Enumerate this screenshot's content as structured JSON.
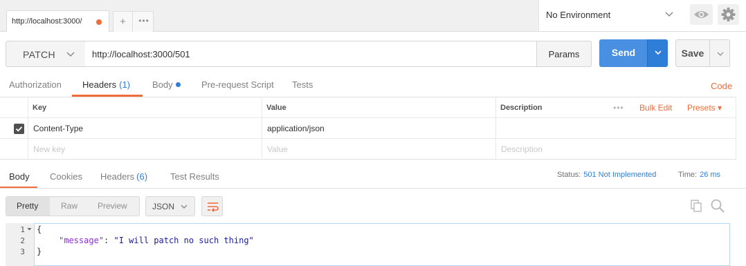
{
  "tabs": {
    "active_tab_label": "http://localhost:3000/",
    "new_tab_glyph": "+",
    "more_glyph": "•••"
  },
  "environment": {
    "selected": "No Environment"
  },
  "request": {
    "method": "PATCH",
    "url": "http://localhost:3000/501",
    "params_label": "Params",
    "send_label": "Send",
    "save_label": "Save"
  },
  "request_tabs": {
    "authorization": "Authorization",
    "headers": "Headers",
    "headers_count": "(1)",
    "body": "Body",
    "prerequest": "Pre-request Script",
    "tests": "Tests",
    "code_link": "Code"
  },
  "headers_table": {
    "columns": {
      "key": "Key",
      "value": "Value",
      "description": "Description"
    },
    "more_glyph": "•••",
    "bulk_edit": "Bulk Edit",
    "presets": "Presets ▾",
    "rows": [
      {
        "key": "Content-Type",
        "value": "application/json",
        "description": "",
        "checked": true
      }
    ],
    "new_row": {
      "key_placeholder": "New key",
      "value_placeholder": "Value",
      "description_placeholder": "Description"
    }
  },
  "response_tabs": {
    "body": "Body",
    "cookies": "Cookies",
    "headers": "Headers",
    "headers_count": "(6)",
    "test_results": "Test Results"
  },
  "response_status": {
    "status_label": "Status:",
    "status_value": "501 Not Implemented",
    "time_label": "Time:",
    "time_value": "26 ms"
  },
  "response_view": {
    "pretty": "Pretty",
    "raw": "Raw",
    "preview": "Preview",
    "format": "JSON"
  },
  "code": {
    "line_numbers": [
      "1",
      "2",
      "3"
    ],
    "line1": "{",
    "line2_key": "\"message\"",
    "line2_sep": ": ",
    "line2_value": "\"I will patch no such thing\"",
    "line3": "}"
  },
  "colors": {
    "accent": "#f26b3a",
    "send_blue": "#4a90e2",
    "link_blue": "#2e7dd7"
  }
}
